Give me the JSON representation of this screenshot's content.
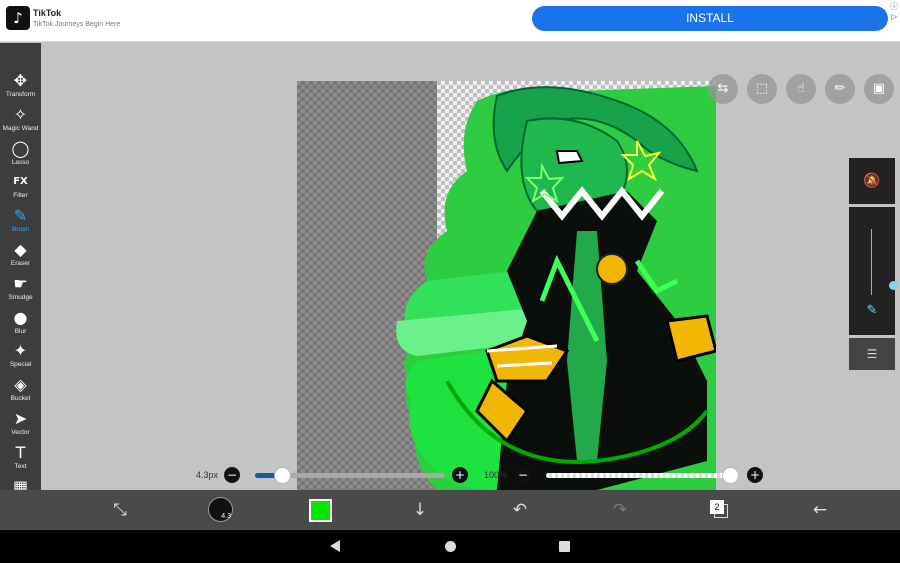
{
  "ad": {
    "app_name": "TikTok",
    "tagline": "TikTok Journeys Begin Here",
    "install_label": "INSTALL",
    "logo_icon": "tiktok-logo-icon",
    "info_icon": "ⓘ",
    "play_icon": "▷"
  },
  "toolbar": {
    "items": [
      {
        "label": "Transform",
        "icon": "✥",
        "icon_name": "transform-icon"
      },
      {
        "label": "Magic Wand",
        "icon": "✧",
        "icon_name": "magic-wand-icon"
      },
      {
        "label": "Lasso",
        "icon": "◯",
        "icon_name": "lasso-icon"
      },
      {
        "label": "Filter",
        "icon": "FX",
        "icon_name": "filter-icon"
      },
      {
        "label": "Brush",
        "icon": "✎",
        "icon_name": "brush-icon",
        "active": true
      },
      {
        "label": "Eraser",
        "icon": "◆",
        "icon_name": "eraser-icon"
      },
      {
        "label": "Smudge",
        "icon": "☛",
        "icon_name": "smudge-icon"
      },
      {
        "label": "Blur",
        "icon": "●",
        "icon_name": "blur-icon"
      },
      {
        "label": "Special",
        "icon": "✦",
        "icon_name": "special-icon"
      },
      {
        "label": "Bucket",
        "icon": "◈",
        "icon_name": "bucket-icon"
      },
      {
        "label": "Vector",
        "icon": "➤",
        "icon_name": "vector-icon"
      },
      {
        "label": "Text",
        "icon": "T",
        "icon_name": "text-icon"
      },
      {
        "label": "Frame Divider",
        "icon": "▦",
        "icon_name": "frame-divider-icon"
      },
      {
        "label": "",
        "icon": "✒",
        "icon_name": "eyedropper-icon"
      }
    ]
  },
  "floating_buttons": [
    {
      "icon": "⇆",
      "icon_name": "toggle-icon"
    },
    {
      "icon": "⬚",
      "icon_name": "selection-icon"
    },
    {
      "icon": "☝",
      "icon_name": "hand-icon"
    },
    {
      "icon": "✏",
      "icon_name": "ruler-icon"
    },
    {
      "icon": "▣",
      "icon_name": "reference-image-icon"
    }
  ],
  "right_panel": {
    "top_icon": "🔕",
    "pen_icon": "✎",
    "bottom_icon": "☰",
    "pressure_level": 0.15
  },
  "sliders": {
    "size_label": "4.3px",
    "opacity_label": "100%",
    "size_level": 0.14,
    "opacity_level": 1.0,
    "minus": "−",
    "plus": "+"
  },
  "bottom_bar": {
    "brush_size_badge": "4.3",
    "color_hex": "#00e600",
    "layer_count": "2",
    "transform_icon": "⤡",
    "download_icon": "↓",
    "undo_icon": "↶",
    "redo_icon": "↷",
    "back_icon": "←"
  }
}
